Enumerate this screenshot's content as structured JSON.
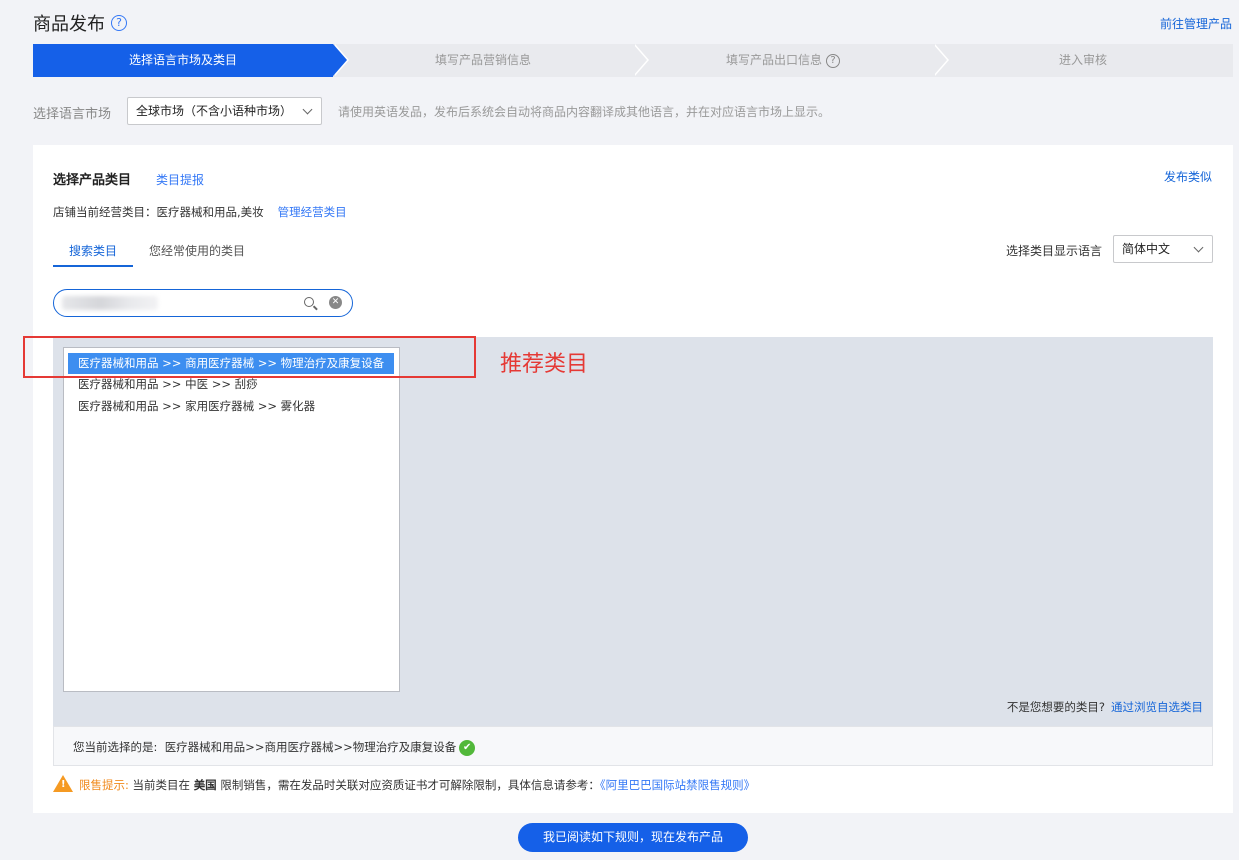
{
  "header": {
    "title": "商品发布",
    "help_icon": "question-circle-icon",
    "manage_link": "前往管理产品"
  },
  "steps": [
    {
      "label": "选择语言市场及类目",
      "active": true
    },
    {
      "label": "填写产品营销信息",
      "active": false
    },
    {
      "label": "填写产品出口信息",
      "active": false
    },
    {
      "label": "进入审核",
      "active": false
    }
  ],
  "market": {
    "label": "选择语言市场",
    "selected": "全球市场（不含小语种市场）",
    "tip": "请使用英语发品，发布后系统会自动将商品内容翻译成其他语言，并在对应语言市场上显示。"
  },
  "category": {
    "title": "选择产品类目",
    "report_link": "类目提报",
    "publish_similar": "发布类似",
    "store_label": "店铺当前经营类目：医疗器械和用品,美妆",
    "manage_link": "管理经营类目",
    "tabs": [
      "搜索类目",
      "您经常使用的类目"
    ],
    "lang_label": "选择类目显示语言",
    "lang_selected": "简体中文",
    "results": [
      "医疗器械和用品 >> 商用医疗器械 >> 物理治疗及康复设备",
      "医疗器械和用品 >> 中医 >> 刮痧",
      "医疗器械和用品 >> 家用医疗器械 >> 雾化器"
    ],
    "annotation": "推荐类目",
    "not_wanted": "不是您想要的类目?",
    "browse_link": "通过浏览自选类目",
    "current_label": "您当前选择的是:",
    "current_value": "医疗器械和用品>>商用医疗器械>>物理治疗及康复设备"
  },
  "warning": {
    "label": "限售提示:",
    "text1": "当前类目在",
    "country": "美国",
    "text2": "限制销售，需在发品时关联对应资质证书才可解除限制，具体信息请参考：",
    "link": "《阿里巴巴国际站禁限售规则》"
  },
  "submit": "我已阅读如下规则，现在发布产品",
  "colors": {
    "primary": "#1560e8",
    "link": "#3478f6",
    "annotation": "#e53935",
    "warning": "#f59a23",
    "success": "#52b83a"
  }
}
